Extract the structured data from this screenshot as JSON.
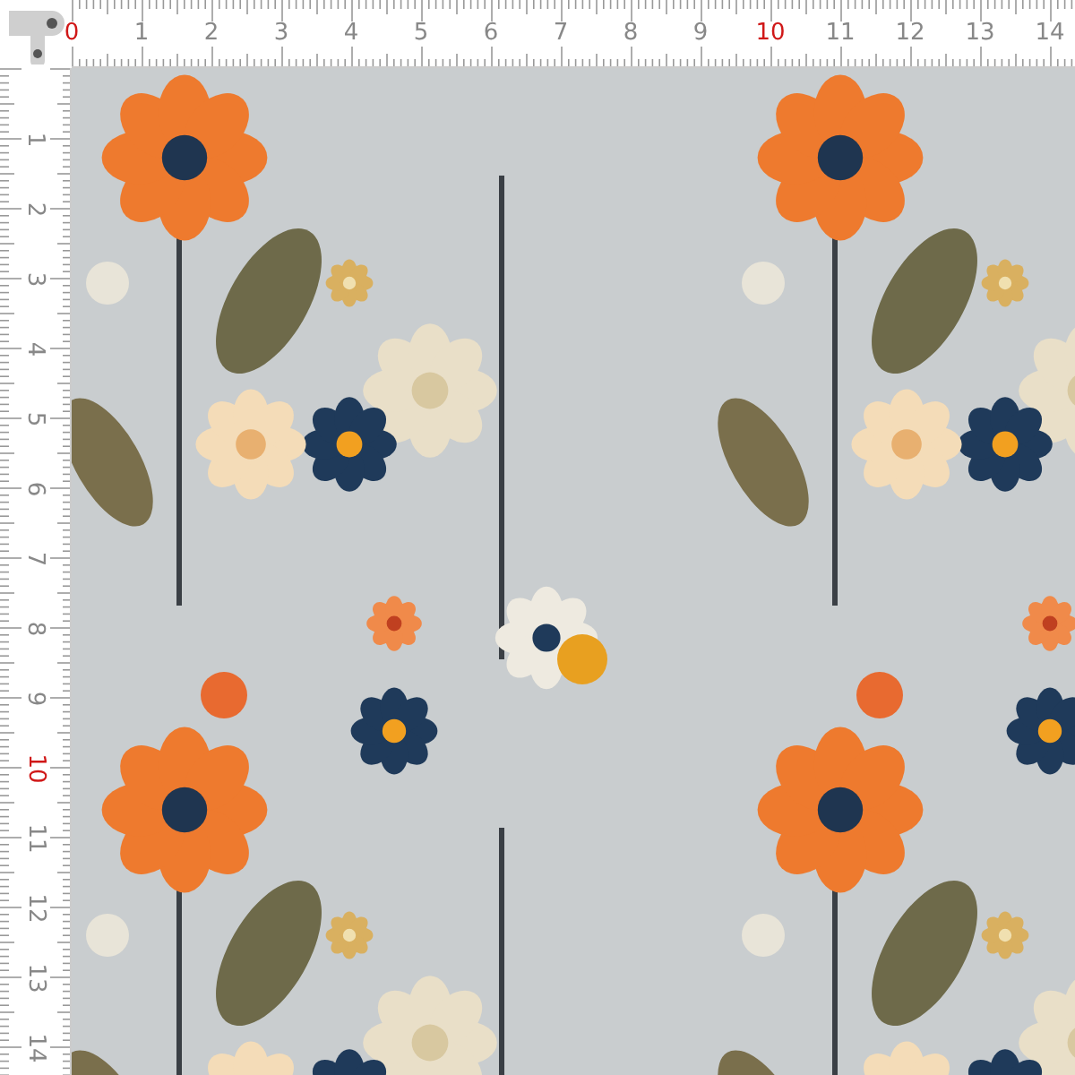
{
  "top_ruler": {
    "labels": [
      {
        "text": "0",
        "highlight": true
      },
      {
        "text": "1",
        "highlight": false
      },
      {
        "text": "2",
        "highlight": false
      },
      {
        "text": "3",
        "highlight": false
      },
      {
        "text": "4",
        "highlight": false
      },
      {
        "text": "5",
        "highlight": false
      },
      {
        "text": "6",
        "highlight": false
      },
      {
        "text": "7",
        "highlight": false
      },
      {
        "text": "8",
        "highlight": false
      },
      {
        "text": "9",
        "highlight": false
      },
      {
        "text": "10",
        "highlight": true
      },
      {
        "text": "11",
        "highlight": false
      },
      {
        "text": "12",
        "highlight": false
      },
      {
        "text": "13",
        "highlight": false
      },
      {
        "text": "14",
        "highlight": false
      }
    ]
  },
  "left_ruler": {
    "labels": [
      {
        "text": "1",
        "highlight": false
      },
      {
        "text": "2",
        "highlight": false
      },
      {
        "text": "3",
        "highlight": false
      },
      {
        "text": "4",
        "highlight": false
      },
      {
        "text": "5",
        "highlight": false
      },
      {
        "text": "6",
        "highlight": false
      },
      {
        "text": "7",
        "highlight": false
      },
      {
        "text": "8",
        "highlight": false
      },
      {
        "text": "9",
        "highlight": false
      },
      {
        "text": "10",
        "highlight": true
      },
      {
        "text": "11",
        "highlight": false
      },
      {
        "text": "12",
        "highlight": false
      },
      {
        "text": "13",
        "highlight": false
      },
      {
        "text": "14",
        "highlight": false
      }
    ]
  }
}
